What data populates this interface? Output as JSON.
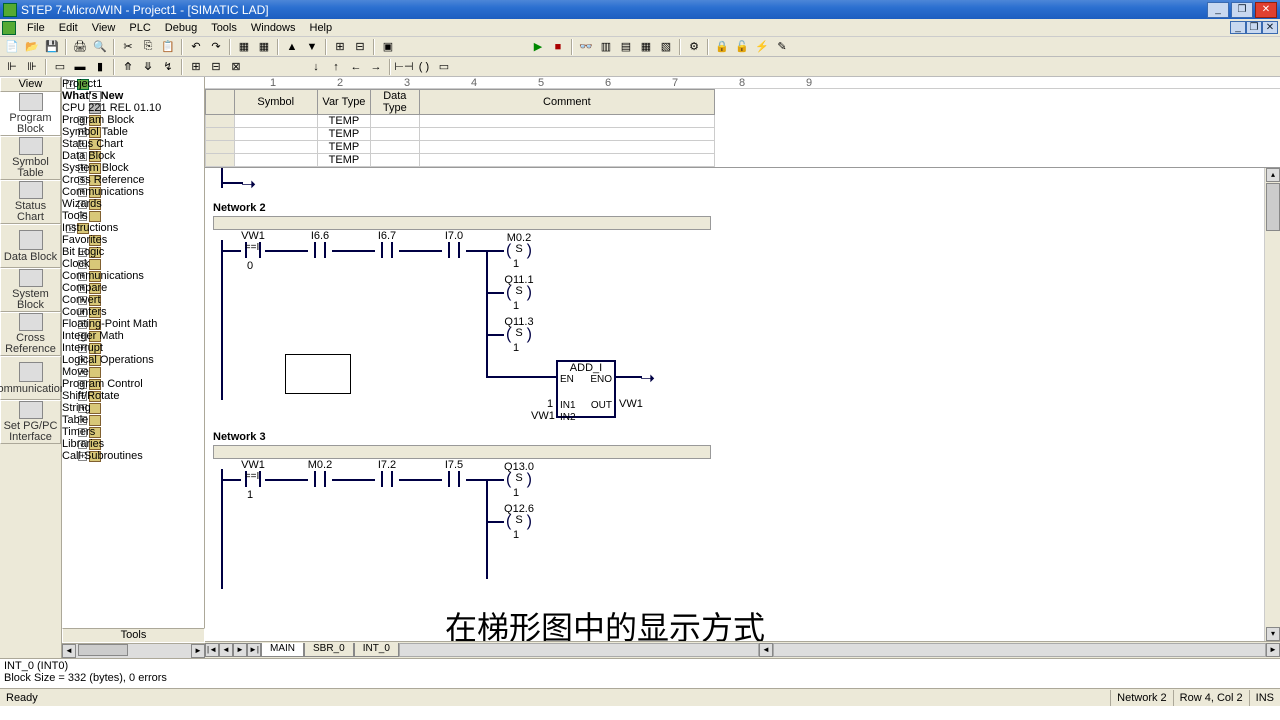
{
  "window": {
    "title": "STEP 7-Micro/WIN - Project1 - [SIMATIC LAD]"
  },
  "menu": [
    "File",
    "Edit",
    "View",
    "PLC",
    "Debug",
    "Tools",
    "Windows",
    "Help"
  ],
  "nav": {
    "header": "View",
    "items": [
      {
        "label": "Program Block"
      },
      {
        "label": "Symbol Table"
      },
      {
        "label": "Status Chart"
      },
      {
        "label": "Data Block"
      },
      {
        "label": "System Block"
      },
      {
        "label": "Cross Reference"
      },
      {
        "label": "Communications"
      },
      {
        "label": "Set PG/PC Interface"
      }
    ],
    "footer": "Tools"
  },
  "tree": [
    {
      "indent": 0,
      "pm": "-",
      "icon": "grn",
      "label": "Project1"
    },
    {
      "indent": 1,
      "pm": "",
      "icon": "page",
      "label": "What's New",
      "bold": true
    },
    {
      "indent": 1,
      "pm": "",
      "icon": "tool",
      "label": "CPU 221 REL 01.10"
    },
    {
      "indent": 1,
      "pm": "+",
      "icon": "fold",
      "label": "Program Block"
    },
    {
      "indent": 1,
      "pm": "+",
      "icon": "fold",
      "label": "Symbol Table"
    },
    {
      "indent": 1,
      "pm": "+",
      "icon": "fold",
      "label": "Status Chart"
    },
    {
      "indent": 1,
      "pm": "+",
      "icon": "fold",
      "label": "Data Block"
    },
    {
      "indent": 1,
      "pm": "+",
      "icon": "fold",
      "label": "System Block"
    },
    {
      "indent": 1,
      "pm": "+",
      "icon": "fold",
      "label": "Cross Reference"
    },
    {
      "indent": 1,
      "pm": "+",
      "icon": "fold",
      "label": "Communications"
    },
    {
      "indent": 1,
      "pm": "+",
      "icon": "fold",
      "label": "Wizards"
    },
    {
      "indent": 1,
      "pm": "+",
      "icon": "fold",
      "label": "Tools"
    },
    {
      "indent": 0,
      "pm": "-",
      "icon": "fold",
      "label": "Instructions"
    },
    {
      "indent": 1,
      "pm": "",
      "icon": "fold",
      "label": "Favorites"
    },
    {
      "indent": 1,
      "pm": "+",
      "icon": "fold",
      "label": "Bit Logic"
    },
    {
      "indent": 1,
      "pm": "+",
      "icon": "fold",
      "label": "Clock"
    },
    {
      "indent": 1,
      "pm": "+",
      "icon": "fold",
      "label": "Communications"
    },
    {
      "indent": 1,
      "pm": "+",
      "icon": "fold",
      "label": "Compare"
    },
    {
      "indent": 1,
      "pm": "+",
      "icon": "fold",
      "label": "Convert"
    },
    {
      "indent": 1,
      "pm": "+",
      "icon": "fold",
      "label": "Counters"
    },
    {
      "indent": 1,
      "pm": "+",
      "icon": "fold",
      "label": "Floating-Point Math"
    },
    {
      "indent": 1,
      "pm": "+",
      "icon": "fold",
      "label": "Integer Math"
    },
    {
      "indent": 1,
      "pm": "+",
      "icon": "fold",
      "label": "Interrupt"
    },
    {
      "indent": 1,
      "pm": "+",
      "icon": "fold",
      "label": "Logical Operations"
    },
    {
      "indent": 1,
      "pm": "+",
      "icon": "fold",
      "label": "Move"
    },
    {
      "indent": 1,
      "pm": "+",
      "icon": "fold",
      "label": "Program Control"
    },
    {
      "indent": 1,
      "pm": "+",
      "icon": "fold",
      "label": "Shift/Rotate"
    },
    {
      "indent": 1,
      "pm": "+",
      "icon": "fold",
      "label": "String"
    },
    {
      "indent": 1,
      "pm": "+",
      "icon": "fold",
      "label": "Table"
    },
    {
      "indent": 1,
      "pm": "+",
      "icon": "fold",
      "label": "Timers"
    },
    {
      "indent": 1,
      "pm": "+",
      "icon": "fold",
      "label": "Libraries"
    },
    {
      "indent": 1,
      "pm": "+",
      "icon": "fold",
      "label": "Call Subroutines"
    }
  ],
  "vartable": {
    "headers": [
      "",
      "Symbol",
      "Var Type",
      "Data Type",
      "Comment"
    ],
    "rows": [
      [
        "",
        "",
        "TEMP",
        "",
        ""
      ],
      [
        "",
        "",
        "TEMP",
        "",
        ""
      ],
      [
        "",
        "",
        "TEMP",
        "",
        ""
      ],
      [
        "",
        "",
        "TEMP",
        "",
        ""
      ]
    ]
  },
  "networks": {
    "n2": {
      "title": "Network 2",
      "contacts": [
        "VW1",
        "I6.6",
        "I6.7",
        "I7.0"
      ],
      "cmpval": "0",
      "coils": [
        {
          "addr": "M0.2",
          "type": "S",
          "val": "1"
        },
        {
          "addr": "Q11.1",
          "type": "S",
          "val": "1"
        },
        {
          "addr": "Q11.3",
          "type": "S",
          "val": "1"
        }
      ],
      "box": {
        "name": "ADD_I",
        "en": "EN",
        "eno": "ENO",
        "in1": "IN1",
        "in2": "IN2",
        "out": "OUT",
        "in1v": "1",
        "in2v": "VW1",
        "outv": "VW1"
      }
    },
    "n3": {
      "title": "Network 3",
      "contacts": [
        "VW1",
        "M0.2",
        "I7.2",
        "I7.5"
      ],
      "cmpval": "1",
      "coils": [
        {
          "addr": "Q13.0",
          "type": "S",
          "val": "1"
        },
        {
          "addr": "Q12.6",
          "type": "S",
          "val": "1"
        }
      ]
    }
  },
  "tabs": [
    "MAIN",
    "SBR_0",
    "INT_0"
  ],
  "output": {
    "line1": "INT_0 (INT0)",
    "line2": "Block Size = 332 (bytes), 0 errors"
  },
  "status": {
    "ready": "Ready",
    "net": "Network 2",
    "pos": "Row 4, Col 2",
    "ins": "INS"
  },
  "subtitle": "在梯形图中的显示方式"
}
